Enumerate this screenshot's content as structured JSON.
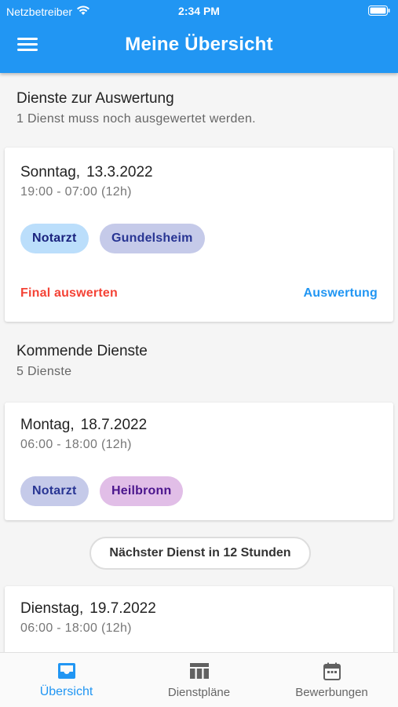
{
  "status_bar": {
    "carrier": "Netzbetreiber",
    "time": "2:34 PM"
  },
  "app_bar": {
    "title": "Meine Übersicht"
  },
  "pending_section": {
    "title": "Dienste zur Auswertung",
    "subtitle": "1 Dienst muss noch ausgewertet werden."
  },
  "pending_card": {
    "weekday": "Sonntag,",
    "date": "13.3.2022",
    "hours": "19:00 - 07:00 (12h)",
    "tags": [
      "Notarzt",
      "Gundelsheim"
    ],
    "action_final": "Final auswerten",
    "action_eval": "Auswertung"
  },
  "upcoming_section": {
    "title": "Kommende Dienste",
    "subtitle": "5 Dienste"
  },
  "upcoming_cards": [
    {
      "weekday": "Montag,",
      "date": "18.7.2022",
      "hours": "06:00 - 18:00 (12h)",
      "tags": [
        "Notarzt",
        "Heilbronn"
      ]
    },
    {
      "weekday": "Dienstag,",
      "date": "19.7.2022",
      "hours": "06:00 - 18:00 (12h)"
    }
  ],
  "next_service_button": "Nächster Dienst in 12 Stunden",
  "bottom_nav": {
    "items": [
      {
        "label": "Übersicht",
        "icon": "inbox-icon",
        "active": true
      },
      {
        "label": "Dienstpläne",
        "icon": "table-icon",
        "active": false
      },
      {
        "label": "Bewerbungen",
        "icon": "calendar-icon",
        "active": false
      }
    ]
  },
  "colors": {
    "primary": "#2196f3",
    "danger": "#f44336",
    "chip_blue": "#bbdefb",
    "chip_indigo": "#c5cae9",
    "chip_purple": "#e1bee7"
  }
}
